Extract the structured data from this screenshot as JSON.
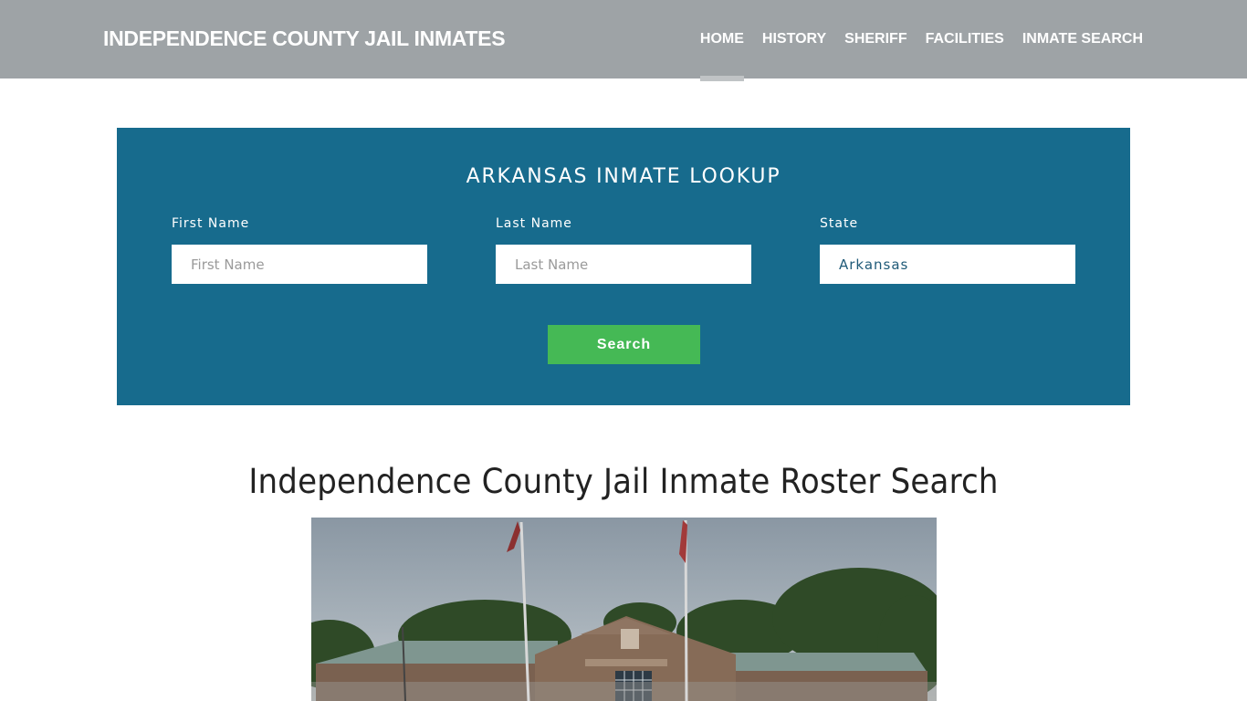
{
  "header": {
    "brand": "INDEPENDENCE COUNTY JAIL INMATES",
    "nav": [
      {
        "label": "HOME",
        "active": true
      },
      {
        "label": "HISTORY",
        "active": false
      },
      {
        "label": "SHERIFF",
        "active": false
      },
      {
        "label": "FACILITIES",
        "active": false
      },
      {
        "label": "INMATE SEARCH",
        "active": false
      }
    ]
  },
  "lookup": {
    "title": "ARKANSAS INMATE LOOKUP",
    "first_name": {
      "label": "First Name",
      "placeholder": "First Name",
      "value": ""
    },
    "last_name": {
      "label": "Last Name",
      "placeholder": "Last Name",
      "value": ""
    },
    "state": {
      "label": "State",
      "value": "Arkansas"
    },
    "search_button": "Search"
  },
  "main": {
    "heading": "Independence County Jail Inmate Roster Search",
    "image_alt": "Independence County Detention Facility building"
  },
  "colors": {
    "navbar": "#9ea3a6",
    "lookup_panel": "#176b8d",
    "search_button": "#45b955"
  }
}
